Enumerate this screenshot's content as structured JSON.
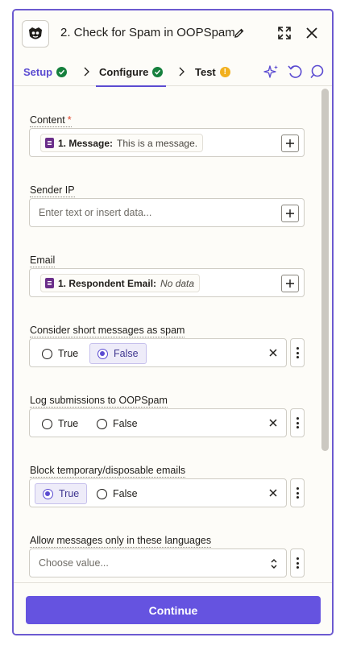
{
  "header": {
    "title": "2. Check for Spam in OOPSpam"
  },
  "tabs": [
    {
      "label": "Setup",
      "status": "complete"
    },
    {
      "label": "Configure",
      "status": "complete"
    },
    {
      "label": "Test",
      "status": "warning",
      "badge": "!"
    }
  ],
  "fields": {
    "content": {
      "label": "Content",
      "required_mark": "*",
      "pill_key": "1. Message:",
      "pill_value": "This is a message."
    },
    "sender_ip": {
      "label": "Sender IP",
      "placeholder": "Enter text or insert data..."
    },
    "email": {
      "label": "Email",
      "pill_key": "1. Respondent Email:",
      "pill_value": "No data"
    },
    "short_messages": {
      "label": "Consider short messages as spam",
      "options": [
        "True",
        "False"
      ],
      "selected": "False"
    },
    "log_submissions": {
      "label": "Log submissions to OOPSpam",
      "options": [
        "True",
        "False"
      ],
      "selected": null
    },
    "block_temp_emails": {
      "label": "Block temporary/disposable emails",
      "options": [
        "True",
        "False"
      ],
      "selected": "True"
    },
    "languages": {
      "label": "Allow messages only in these languages",
      "placeholder": "Choose value..."
    }
  },
  "footer": {
    "continue_label": "Continue"
  },
  "colors": {
    "accent": "#6553e0",
    "border": "#6c5ad0",
    "success": "#15803d",
    "warning": "#f2b01e"
  },
  "icons": [
    "oopspam-logo-icon",
    "pencil-icon",
    "expand-icon",
    "close-icon",
    "check-circle-icon",
    "chevron-right-icon",
    "warning-icon",
    "sparkle-icon",
    "undo-icon",
    "comment-icon",
    "plus-icon",
    "clear-x-icon",
    "kebab-menu-icon",
    "updown-chevron-icon"
  ]
}
